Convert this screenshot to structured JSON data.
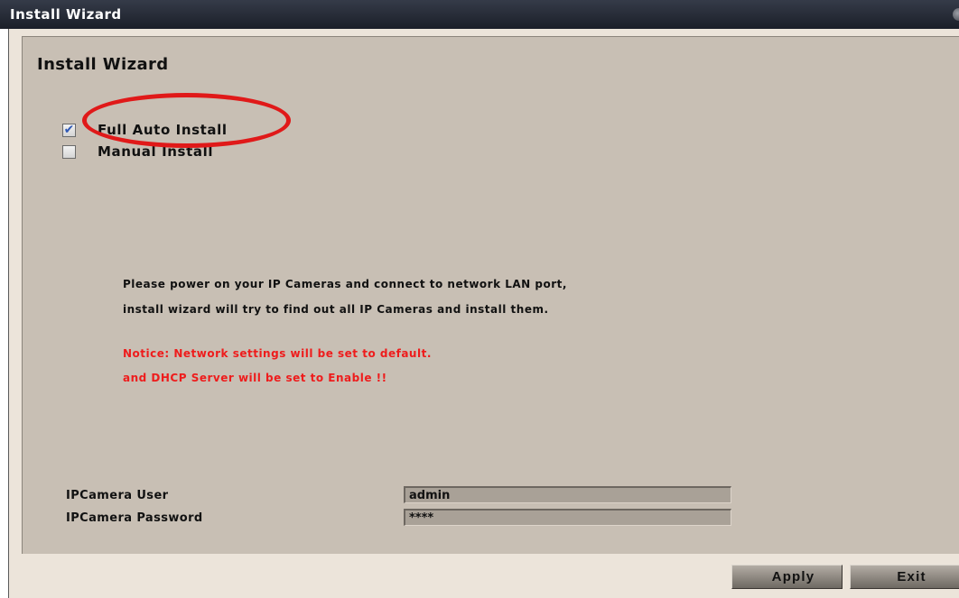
{
  "window": {
    "title": "Install Wizard"
  },
  "panel": {
    "heading": "Install Wizard"
  },
  "options": [
    {
      "label": "Full Auto Install",
      "checked": true
    },
    {
      "label": "Manual Install",
      "checked": false
    }
  ],
  "checkmark": "✔",
  "message": {
    "line1": "Please power on your IP Cameras and connect to network LAN port,",
    "line2": "install wizard will try to find out all IP Cameras and install them."
  },
  "notice": {
    "line1": "Notice: Network settings will be set to default.",
    "line2": "and DHCP Server will be set to Enable !!",
    "color": "#ee1c1c"
  },
  "fields": {
    "user_label": "IPCamera User",
    "user_value": "admin",
    "password_label": "IPCamera Password",
    "password_value": "****"
  },
  "buttons": {
    "apply": "Apply",
    "exit": "Exit"
  },
  "highlight": {
    "color": "#e01919",
    "target": "Full Auto Install"
  }
}
